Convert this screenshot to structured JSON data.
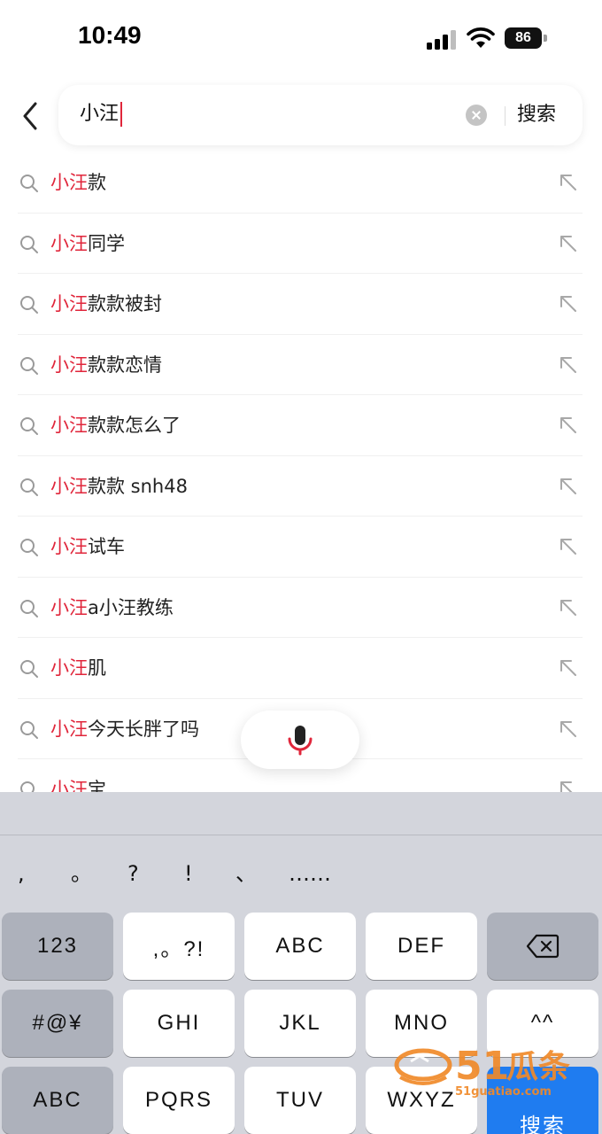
{
  "status_bar": {
    "time": "10:49",
    "battery": "86"
  },
  "search": {
    "query": "小汪",
    "button_label": "搜索"
  },
  "suggestions": [
    {
      "prefix": "小汪",
      "rest": "款"
    },
    {
      "prefix": "小汪",
      "rest": "同学"
    },
    {
      "prefix": "小汪",
      "rest": "款款被封"
    },
    {
      "prefix": "小汪",
      "rest": "款款恋情"
    },
    {
      "prefix": "小汪",
      "rest": "款款怎么了"
    },
    {
      "prefix": "小汪",
      "rest": "款款 snh48"
    },
    {
      "prefix": "小汪",
      "rest": "试车"
    },
    {
      "prefix": "小汪",
      "rest": "a小汪教练"
    },
    {
      "prefix": "小汪",
      "rest": "肌"
    },
    {
      "prefix": "小汪",
      "rest": "今天长胖了吗"
    },
    {
      "prefix": "小汪",
      "rest": "宝"
    }
  ],
  "keyboard": {
    "punctuation": [
      ",",
      "。",
      "?",
      "!",
      "、",
      "……"
    ],
    "rows": [
      [
        "123",
        ",。?!",
        "ABC",
        "DEF",
        "delete"
      ],
      [
        "#@¥",
        "GHI",
        "JKL",
        "MNO",
        "^^"
      ],
      [
        "ABC",
        "PQRS",
        "TUV",
        "WXYZ",
        "搜索"
      ]
    ]
  },
  "watermark": {
    "brand": "51瓜条",
    "site": "51guatiao.com"
  },
  "colors": {
    "accent": "#e0263b",
    "keyboard_bg": "#d3d5dc",
    "action_key": "#1f7cf0"
  }
}
